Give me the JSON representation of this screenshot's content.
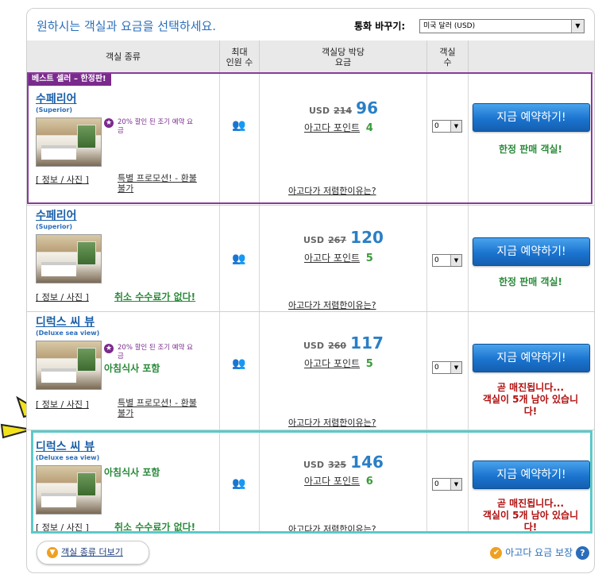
{
  "header": {
    "title": "원하시는 객실과 요금을 선택하세요.",
    "currency_label": "통화 바꾸기:",
    "currency_value": "미국 달러 (USD)"
  },
  "columns": {
    "room_type": "객실 종류",
    "max_guests": "최대\n인원 수",
    "price": "객실당 박당\n요금",
    "rooms": "객실\n수"
  },
  "common": {
    "info_link": "[ 정보 / 사진 ]",
    "book_label": "지금 예약하기!",
    "why_cheap": "아고다가 저렴한이유는?",
    "points_label": "아고다 포인트",
    "currency": "USD",
    "qty_value": "0",
    "limited_text": "한정 판매 객실!",
    "soldout_text": "곧 매진됩니다...\n객실이 5개 남아 있습니\n다!",
    "promo_text": "20% 할인 된 조기 예약 요\n금",
    "special_promo": "특별 프로모션! - 환불\n불가",
    "free_cancel": "취소 수수료가 없다!",
    "breakfast": "아침식사 포함"
  },
  "best_seller_badge": "베스트 셀러 – 한정판!",
  "rooms": [
    {
      "name": "수페리어",
      "sub": "(Superior)",
      "old_price": "214",
      "new_price": "96",
      "points": "4"
    },
    {
      "name": "수페리어",
      "sub": "(Superior)",
      "old_price": "267",
      "new_price": "120",
      "points": "5"
    },
    {
      "name": "디럭스 씨 뷰",
      "sub": "(Deluxe sea view)",
      "old_price": "260",
      "new_price": "117",
      "points": "5"
    },
    {
      "name": "디럭스 씨 뷰",
      "sub": "(Deluxe sea view)",
      "old_price": "325",
      "new_price": "146",
      "points": "6"
    }
  ],
  "footer": {
    "more_rooms": "객실 종류 더보기",
    "guarantee": "아고다 요금 보장",
    "help": "?"
  },
  "colors": {
    "accent_blue": "#2a6ebb",
    "best_seller_purple": "#7a2a8c",
    "highlight_teal": "#5cc9c9",
    "soldout_red": "#b01010",
    "green": "#2a8a3a"
  }
}
